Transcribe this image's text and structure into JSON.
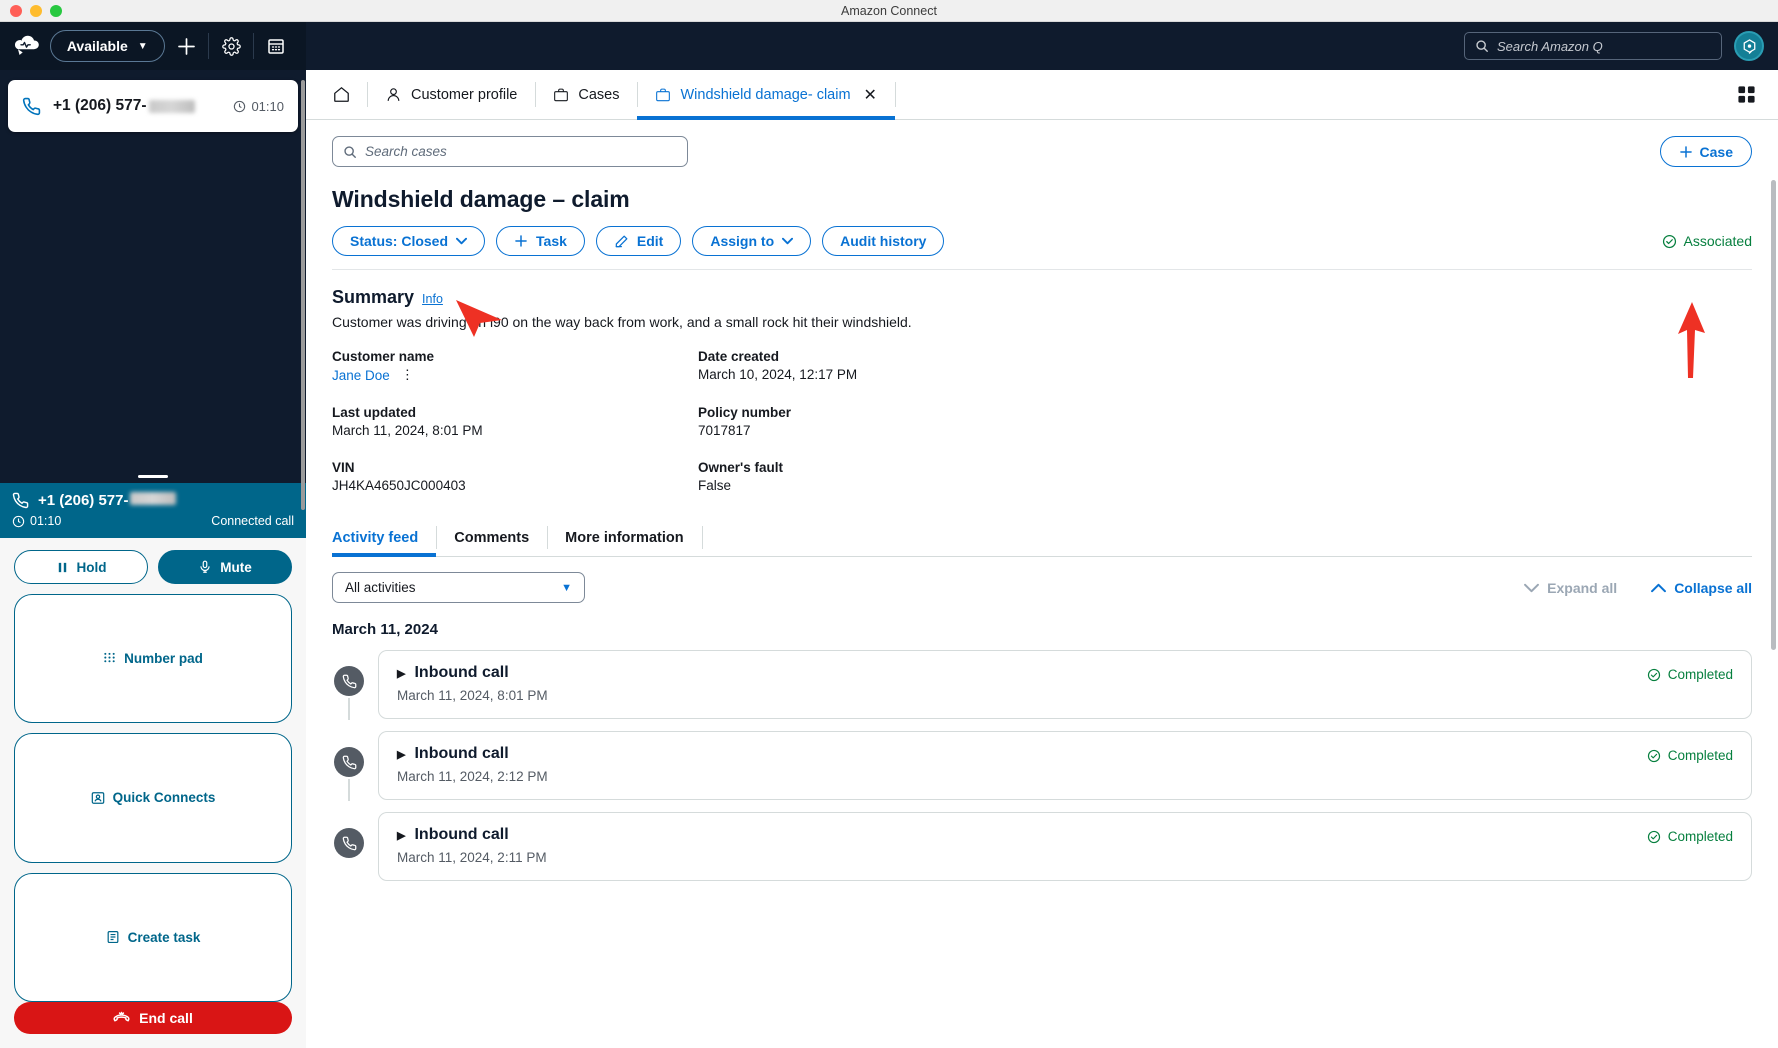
{
  "window": {
    "title": "Amazon Connect"
  },
  "ccp": {
    "logo_icon": "amazon-connect-cloud-logo",
    "status": {
      "label": "Available",
      "caret": "▼"
    },
    "add_icon": "plus-icon",
    "settings_icon": "gear-icon",
    "calendar_icon": "calendar-icon",
    "contact_card": {
      "phone_icon": "phone-icon",
      "number": "+1 (206) 577-",
      "clock_icon": "clock-icon",
      "timer": "01:10"
    },
    "call_banner": {
      "phone_icon": "phone-icon",
      "number": "+1 (206) 577-",
      "clock_icon": "clock-icon",
      "timer": "01:10",
      "state": "Connected call"
    },
    "controls": {
      "hold": "Hold",
      "hold_icon": "pause-icon",
      "mute": "Mute",
      "mute_icon": "microphone-icon",
      "number_pad": "Number pad",
      "number_pad_icon": "dialpad-icon",
      "quick_connects": "Quick Connects",
      "quick_connects_icon": "contact-card-icon",
      "create_task": "Create task",
      "create_task_icon": "task-icon",
      "end_call": "End call",
      "end_call_icon": "end-call-handset-icon"
    }
  },
  "topbar": {
    "search": {
      "placeholder": "Search Amazon Q",
      "icon": "search-icon"
    },
    "avatar_icon": "amazon-q-avatar-icon"
  },
  "tabs": {
    "home_icon": "home-icon",
    "items": [
      {
        "label": "Customer profile",
        "icon": "user-icon",
        "active": false
      },
      {
        "label": "Cases",
        "icon": "briefcase-icon",
        "active": false
      },
      {
        "label": "Windshield damage- claim",
        "icon": "briefcase-icon",
        "active": true,
        "close_icon": "close-icon"
      }
    ],
    "grid_icon": "apps-grid-icon"
  },
  "toolbar": {
    "search_placeholder": "Search cases",
    "search_icon": "search-icon",
    "case_button": "Case",
    "case_button_icon": "plus-icon"
  },
  "case": {
    "title": "Windshield damage – claim",
    "actions": [
      {
        "label": "Status: Closed",
        "icon": "chevron-down-icon",
        "name": "status-button"
      },
      {
        "label": "Task",
        "icon": "plus-icon",
        "name": "task-button"
      },
      {
        "label": "Edit",
        "icon": "pencil-icon",
        "name": "edit-button"
      },
      {
        "label": "Assign to",
        "icon": "chevron-down-icon",
        "name": "assign-to-button"
      },
      {
        "label": "Audit history",
        "icon": "",
        "name": "audit-history-button"
      }
    ],
    "associated": {
      "label": "Associated",
      "icon": "check-circle-icon",
      "color": "#067f3e"
    },
    "summary": {
      "heading": "Summary",
      "info_link": "Info",
      "text": "Customer was driving on i90 on the way back from work, and a small rock hit their windshield."
    },
    "fields": [
      {
        "label": "Customer name",
        "value": "Jane Doe",
        "link": true,
        "kebab": true
      },
      {
        "label": "Date created",
        "value": "March 10, 2024, 12:17 PM",
        "link": false,
        "kebab": false
      },
      {
        "label": "Last updated",
        "value": "March 11, 2024, 8:01 PM",
        "link": false,
        "kebab": false
      },
      {
        "label": "Policy number",
        "value": "7017817",
        "link": false,
        "kebab": false
      },
      {
        "label": "VIN",
        "value": "JH4KA4650JC000403",
        "link": false,
        "kebab": false
      },
      {
        "label": "Owner's fault",
        "value": "False",
        "link": false,
        "kebab": false
      }
    ]
  },
  "detail_tabs": [
    {
      "label": "Activity feed",
      "active": true
    },
    {
      "label": "Comments",
      "active": false
    },
    {
      "label": "More information",
      "active": false
    }
  ],
  "activity": {
    "filter": {
      "value": "All activities",
      "caret": "▼"
    },
    "expand_all": {
      "label": "Expand all",
      "icon": "chevron-down-icon",
      "enabled": false
    },
    "collapse_all": {
      "label": "Collapse all",
      "icon": "chevron-up-icon",
      "enabled": true
    },
    "date_group": "March 11, 2024",
    "items": [
      {
        "title": "Inbound call",
        "timestamp": "March 11, 2024, 8:01 PM",
        "status": "Completed",
        "icon": "phone-icon",
        "expand_icon": "triangle-right-icon"
      },
      {
        "title": "Inbound call",
        "timestamp": "March 11, 2024, 2:12 PM",
        "status": "Completed",
        "icon": "phone-icon",
        "expand_icon": "triangle-right-icon"
      },
      {
        "title": "Inbound call",
        "timestamp": "March 11, 2024, 2:11 PM",
        "status": "Completed",
        "icon": "phone-icon",
        "expand_icon": "triangle-right-icon"
      }
    ]
  },
  "annotations": {
    "arrow_color": "#ee3124",
    "arrows": [
      "status-button-pointer",
      "associated-badge-pointer"
    ]
  },
  "colors": {
    "nav_bg": "#0f1b2d",
    "accent_blue": "#0972d3",
    "ccp_teal": "#00668a",
    "danger_red": "#d91515",
    "success_green": "#067f3e"
  }
}
